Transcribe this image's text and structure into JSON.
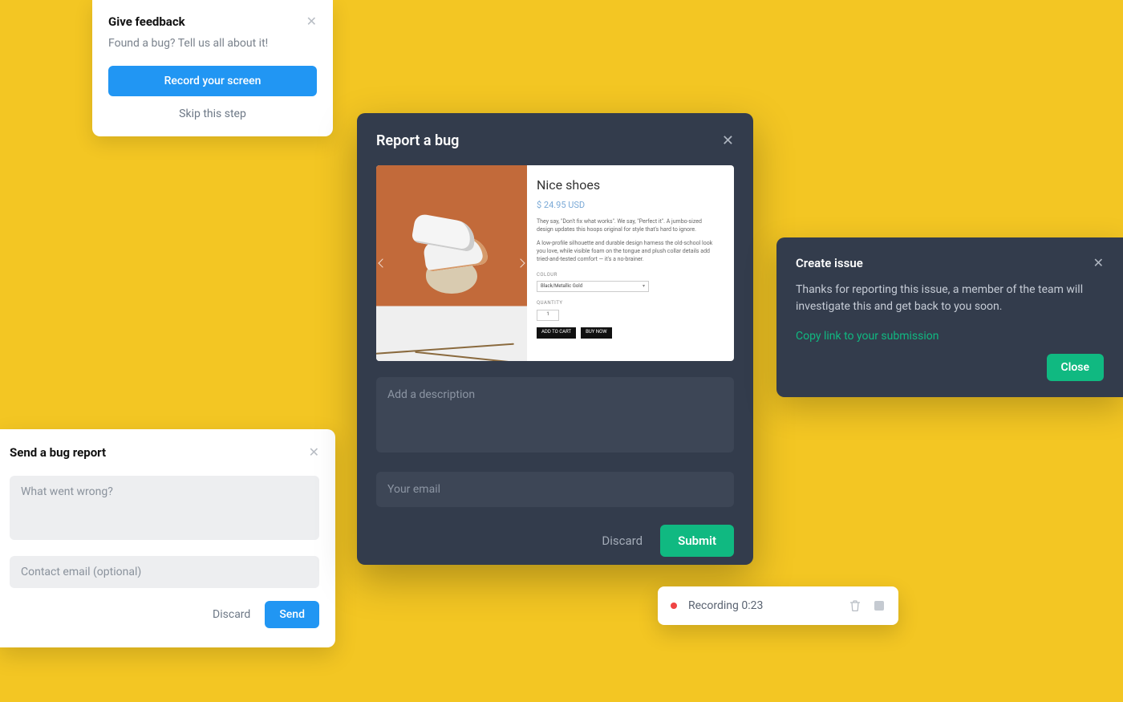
{
  "feedback": {
    "title": "Give feedback",
    "subtitle": "Found a bug? Tell us all about it!",
    "record_button": "Record your screen",
    "skip_link": "Skip this step"
  },
  "bug_report": {
    "title": "Send a bug report",
    "description_placeholder": "What went wrong?",
    "email_placeholder": "Contact email (optional)",
    "discard_label": "Discard",
    "send_label": "Send"
  },
  "report_bug": {
    "title": "Report a bug",
    "description_placeholder": "Add a description",
    "email_placeholder": "Your email",
    "discard_label": "Discard",
    "submit_label": "Submit",
    "screenshot": {
      "product_title": "Nice shoes",
      "price": "$ 24.95 USD",
      "para1": "They say, \"Don't fix what works\". We say, \"Perfect it\". A jumbo-sized design updates this hoops original for style that's hard to ignore.",
      "para2": "A low-profile silhouette and durable design harness the old-school look you love, while visible foam on the tongue and plush collar details add tried-and-tested comfort — it's a no-brainer.",
      "colour_label": "COLOUR",
      "colour_value": "Black/Metallic Gold",
      "quantity_label": "QUANTITY",
      "quantity_value": "1",
      "add_to_cart": "ADD TO CART",
      "buy_now": "BUY NOW"
    }
  },
  "create_issue": {
    "title": "Create issue",
    "body": "Thanks for reporting this issue, a member of the team will investigate this and get back to you soon.",
    "copy_link": "Copy link to your submission",
    "close_label": "Close"
  },
  "recording": {
    "text": "Recording 0:23"
  }
}
